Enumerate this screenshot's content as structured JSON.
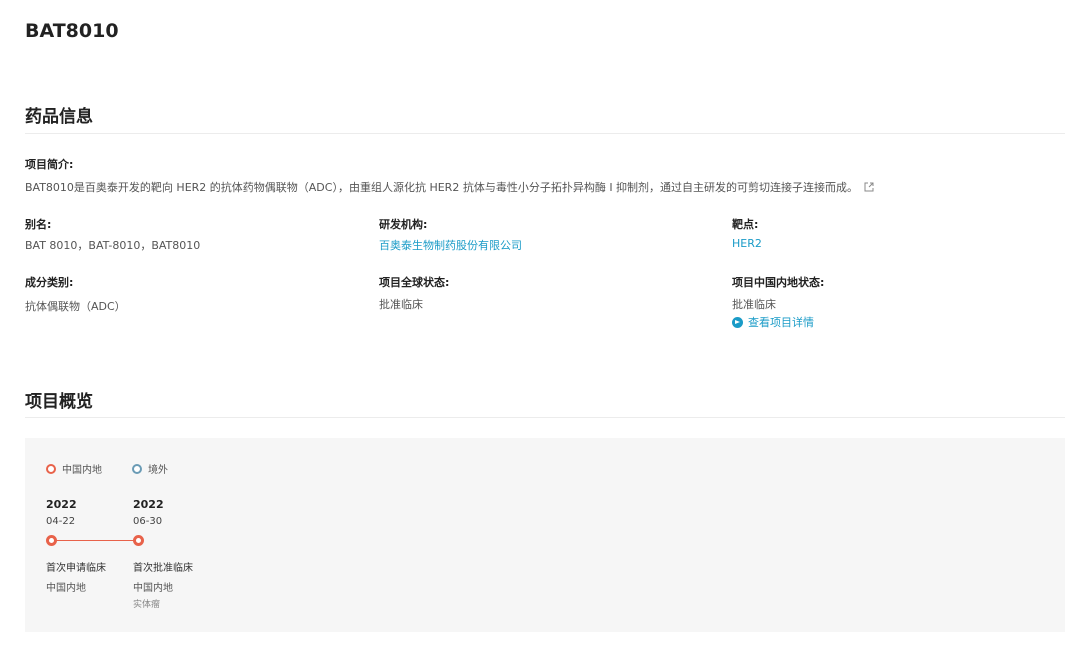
{
  "page_title": "BAT8010",
  "drug_info": {
    "section_title": "药品信息",
    "intro_label": "项目简介:",
    "intro_text": "BAT8010是百奥泰开发的靶向 HER2 的抗体药物偶联物（ADC），由重组人源化抗 HER2 抗体与毒性小分子拓扑异构酶 I 抑制剂，通过自主研发的可剪切连接子连接而成。",
    "alias_label": "别名:",
    "alias_value": "BAT 8010，BAT-8010，BAT8010",
    "org_label": "研发机构:",
    "org_value": "百奥泰生物制药股份有限公司",
    "target_label": "靶点:",
    "target_value": "HER2",
    "component_label": "成分类别:",
    "component_value": "抗体偶联物（ADC）",
    "global_status_label": "项目全球状态:",
    "global_status_value": "批准临床",
    "china_status_label": "项目中国内地状态:",
    "china_status_value": "批准临床",
    "detail_link": "查看项目详情"
  },
  "overview": {
    "section_title": "项目概览",
    "legend": [
      {
        "label": "中国内地",
        "color": "#e8624a"
      },
      {
        "label": "境外",
        "color": "#6a9bb5"
      }
    ],
    "events": [
      {
        "year": "2022",
        "date": "04-22",
        "event": "首次申请临床",
        "region": "中国内地",
        "extra": ""
      },
      {
        "year": "2022",
        "date": "06-30",
        "event": "首次批准临床",
        "region": "中国内地",
        "extra": "实体瘤"
      }
    ]
  }
}
